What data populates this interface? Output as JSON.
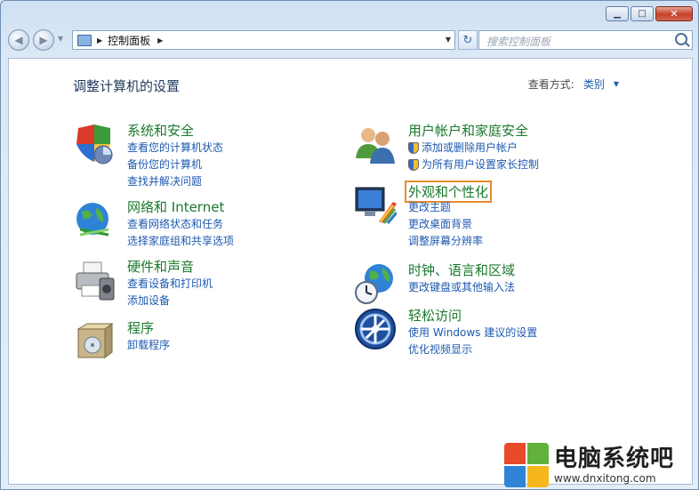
{
  "window": {
    "caption": {
      "minimize": "▁",
      "maximize": "□",
      "close": "✕"
    }
  },
  "nav": {
    "back_icon": "◀",
    "forward_icon": "▶",
    "breadcrumb_arrow": "▶",
    "breadcrumb": "控制面板",
    "breadcrumb_end_arrow": "▶",
    "address_dropdown": "▼",
    "refresh_icon": "↻",
    "search_placeholder": "搜索控制面板"
  },
  "content": {
    "title": "调整计算机的设置",
    "view_label": "查看方式:",
    "view_value": "类别",
    "view_dropdown": "▼"
  },
  "categories_left": [
    {
      "name": "系统和安全",
      "links": [
        "查看您的计算机状态",
        "备份您的计算机",
        "查找并解决问题"
      ]
    },
    {
      "name": "网络和 Internet",
      "links": [
        "查看网络状态和任务",
        "选择家庭组和共享选项"
      ]
    },
    {
      "name": "硬件和声音",
      "links": [
        "查看设备和打印机",
        "添加设备"
      ]
    },
    {
      "name": "程序",
      "links": [
        "卸载程序"
      ]
    }
  ],
  "categories_right": [
    {
      "name": "用户帐户和家庭安全",
      "links": [
        "添加或删除用户帐户",
        "为所有用户设置家长控制"
      ]
    },
    {
      "name": "外观和个性化",
      "links": [
        "更改主题",
        "更改桌面背景",
        "调整屏幕分辨率"
      ]
    },
    {
      "name": "时钟、语言和区域",
      "links": [
        "更改键盘或其他输入法"
      ]
    },
    {
      "name": "轻松访问",
      "links": [
        "使用 Windows 建议的设置",
        "优化视频显示"
      ]
    }
  ],
  "watermark": {
    "title": "电脑系统吧",
    "url": "www.dnxitong.com"
  },
  "colors": {
    "category_green": "#1a7a2c",
    "link_blue": "#1e5ab0",
    "highlight_orange": "#e98a2a"
  }
}
